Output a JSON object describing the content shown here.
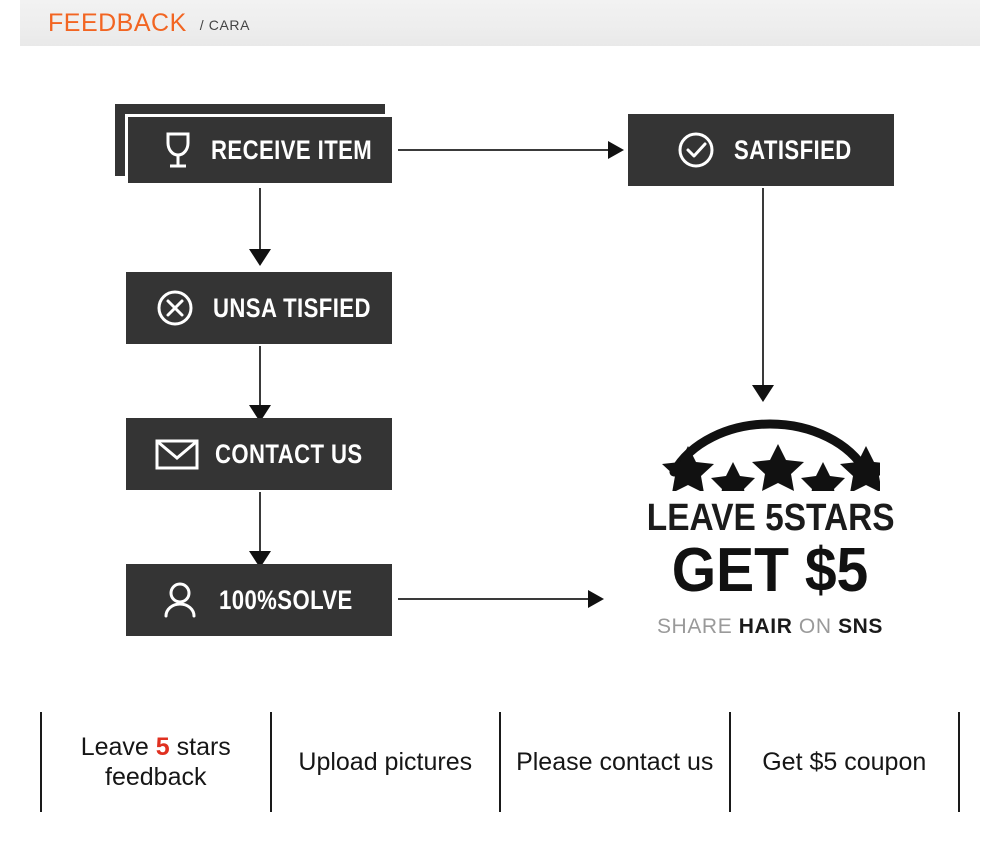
{
  "header": {
    "title": "FEEDBACK",
    "subtitle": "/ CARA",
    "accent_color": "#f26522",
    "bar_color": "#eeeeee"
  },
  "flow": {
    "box_color": "#343434",
    "text_color": "#ffffff",
    "nodes": [
      {
        "id": "receive-item",
        "label": "RECEIVE ITEM",
        "icon": "wine-glass-icon",
        "stacked": true
      },
      {
        "id": "satisfied",
        "label": "SATISFIED",
        "icon": "check-circle-icon",
        "stacked": false
      },
      {
        "id": "unsatisfied",
        "label": "UNSA TISFIED",
        "icon": "x-circle-icon",
        "stacked": false
      },
      {
        "id": "contact-us",
        "label": "CONTACT US",
        "icon": "envelope-icon",
        "stacked": false
      },
      {
        "id": "solve",
        "label": "100%SOLVE",
        "icon": "person-icon",
        "stacked": false
      }
    ],
    "connectors": [
      {
        "id": "receive-to-satisfied",
        "direction": "right"
      },
      {
        "id": "receive-to-unsatisfied",
        "direction": "down"
      },
      {
        "id": "unsatisfied-to-contact",
        "direction": "down"
      },
      {
        "id": "contact-to-solve",
        "direction": "down"
      },
      {
        "id": "satisfied-to-stars",
        "direction": "down"
      },
      {
        "id": "solve-to-stars",
        "direction": "right"
      }
    ]
  },
  "promo": {
    "stars_icon": "five-stars-arc-icon",
    "star_count": 5,
    "line1": "LEAVE 5STARS",
    "line2": "GET $5",
    "share_prefix": "SHARE",
    "share_strong1": "HAIR",
    "share_middle": "ON",
    "share_strong2": "SNS",
    "muted_color": "#9a9a9a",
    "strong_color": "#1a1a1a"
  },
  "benefits": {
    "highlight_color": "#e03020",
    "items": [
      {
        "id": "leave-5-stars-feedback",
        "pre": "Leave ",
        "highlight": "5",
        "post": " stars feedback"
      },
      {
        "id": "upload-pictures",
        "pre": "Upload pictures",
        "highlight": "",
        "post": ""
      },
      {
        "id": "please-contact-us",
        "pre": "Please contact us",
        "highlight": "",
        "post": ""
      },
      {
        "id": "get-5-coupon",
        "pre": "Get $5 coupon",
        "highlight": "",
        "post": ""
      }
    ]
  }
}
